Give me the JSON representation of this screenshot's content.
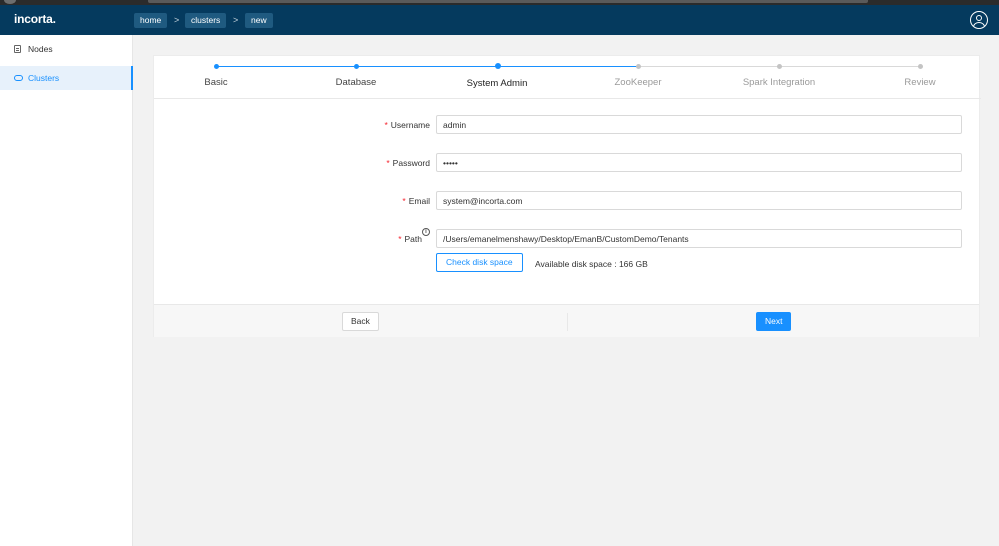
{
  "app": {
    "logo": "incorta."
  },
  "breadcrumb": {
    "items": [
      "home",
      "clusters",
      "new"
    ],
    "separator": ">"
  },
  "sidebar": {
    "items": [
      {
        "label": "Nodes",
        "icon": "nodes-icon"
      },
      {
        "label": "Clusters",
        "icon": "cloud-icon",
        "active": true
      }
    ]
  },
  "wizard": {
    "steps": [
      {
        "label": "Basic",
        "state": "done"
      },
      {
        "label": "Database",
        "state": "done"
      },
      {
        "label": "System Admin",
        "state": "current"
      },
      {
        "label": "ZooKeeper",
        "state": "pending"
      },
      {
        "label": "Spark Integration",
        "state": "pending"
      },
      {
        "label": "Review",
        "state": "pending"
      }
    ]
  },
  "form": {
    "username": {
      "label": "Username",
      "value": "admin"
    },
    "password": {
      "label": "Password",
      "value": "•••••"
    },
    "email": {
      "label": "Email",
      "value": "system@incorta.com"
    },
    "path": {
      "label": "Path",
      "value": "/Users/emanelmenshawy/Desktop/EmanB/CustomDemo/Tenants"
    },
    "required_mark": "*",
    "check_disk_label": "Check disk space",
    "disk_space_text": "Available disk space : 166 GB",
    "info_glyph": "i"
  },
  "footer": {
    "back_label": "Back",
    "next_label": "Next"
  },
  "colors": {
    "header": "#053a5e",
    "accent": "#1890ff",
    "required": "#f5222d"
  }
}
